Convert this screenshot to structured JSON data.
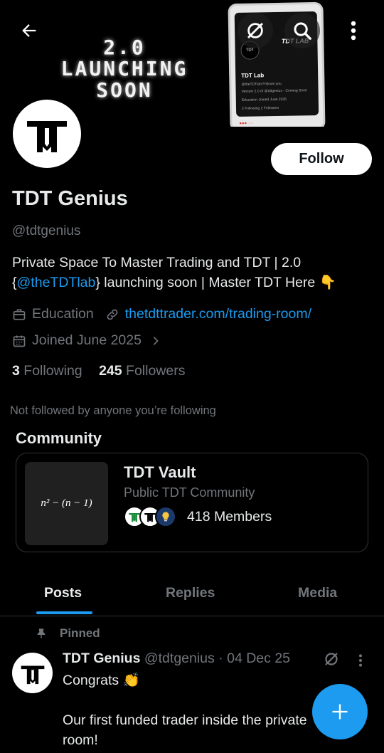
{
  "banner": {
    "line1": "2.0",
    "line2": "LAUNCHING",
    "line3": "SOON",
    "mock_phone": {
      "brand": "TDT LAB",
      "title": "TDT Lab",
      "handle_line": "@theTDTlab",
      "follows_you": "Follows you",
      "bio_line": "Version 2.0 of @tdtgenius - Coming Soon",
      "meta_line": "Education  Joined June 2025",
      "stats_line": "2 Following  2 Followers",
      "logo_text": "TDT"
    }
  },
  "header": {
    "back_icon": "arrow-left-icon",
    "grok_icon": "grok-icon",
    "search_icon": "search-icon",
    "more_icon": "more-vertical-icon"
  },
  "profile": {
    "avatar_text": "TDT",
    "follow_label": "Follow",
    "name": "TDT Genius",
    "handle": "@tdtgenius",
    "bio_part1": "Private Space To Master Trading and TDT | 2.0 {",
    "bio_mention": "@theTDTlab",
    "bio_part2": "} launching soon | Master TDT Here 👇",
    "category": "Education",
    "website": "thetdttrader.com/trading-room/",
    "joined": "Joined June 2025",
    "following_count": "3",
    "following_label": "Following",
    "followers_count": "245",
    "followers_label": "Followers",
    "not_followed": "Not followed by anyone you’re following"
  },
  "community": {
    "section_title": "Community",
    "thumb_text": "n² − (n − 1)",
    "name": "TDT Vault",
    "type": "Public TDT Community",
    "members": "418 Members"
  },
  "tabs": [
    {
      "label": "Posts",
      "active": true
    },
    {
      "label": "Replies",
      "active": false
    },
    {
      "label": "Media",
      "active": false
    }
  ],
  "post": {
    "pinned_label": "Pinned",
    "author": "TDT Genius",
    "meta": "@tdtgenius · 04 Dec 25",
    "line1": "Congrats 👏",
    "line2": "Our first funded trader inside the private room!"
  },
  "colors": {
    "accent": "#1d9bf0",
    "background": "#000000",
    "muted": "#71767b",
    "text": "#e7e9ea"
  }
}
